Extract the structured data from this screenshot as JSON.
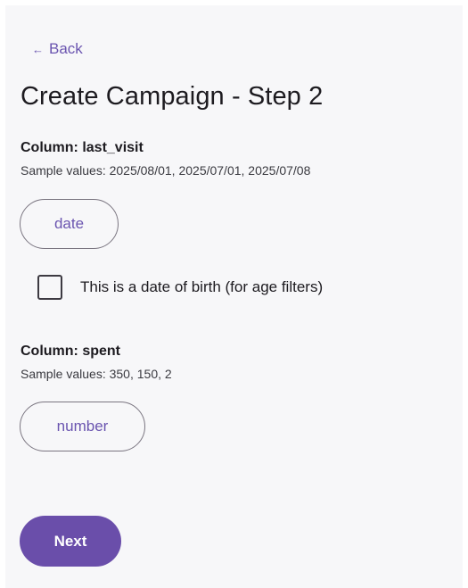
{
  "nav": {
    "back_arrow": "←",
    "back_label": "Back"
  },
  "page": {
    "title": "Create Campaign - Step 2"
  },
  "columns": [
    {
      "title": "Column: last_visit",
      "samples": "Sample values: 2025/08/01, 2025/07/01, 2025/07/08",
      "type_label": "date",
      "dob_checkbox": {
        "label": "This is a date of birth (for age filters)",
        "checked": false
      }
    },
    {
      "title": "Column: spent",
      "samples": "Sample values: 350, 150, 2",
      "type_label": "number"
    }
  ],
  "actions": {
    "next_label": "Next"
  },
  "colors": {
    "accent": "#6a4eaa",
    "link": "#6b55b0",
    "background": "#f7f7f9"
  }
}
